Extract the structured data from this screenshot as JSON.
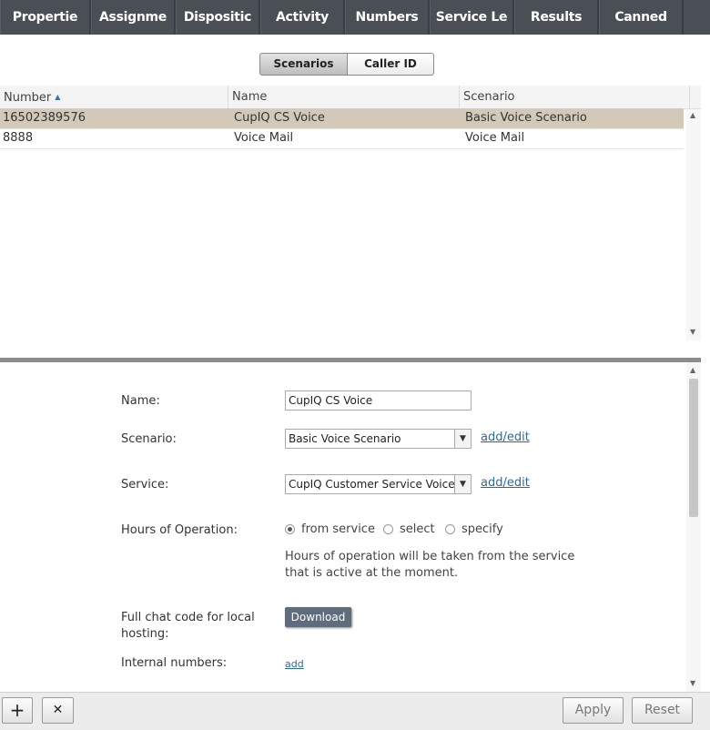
{
  "tabs": [
    "Propertie",
    "Assignme",
    "Dispositic",
    "Activity",
    "Numbers",
    "Service Le",
    "Results",
    "Canned"
  ],
  "segmented": {
    "scenarios": "Scenarios",
    "caller_id": "Caller ID"
  },
  "table": {
    "headers": [
      "Number",
      "Name",
      "Scenario"
    ],
    "rows": [
      {
        "number": "16502389576",
        "name": "CupIQ CS Voice",
        "scenario": "Basic Voice Scenario",
        "selected": true
      },
      {
        "number": "8888",
        "name": "Voice Mail",
        "scenario": "Voice Mail",
        "selected": false
      }
    ]
  },
  "form": {
    "name_label": "Name:",
    "name_value": "CupIQ CS Voice",
    "scenario_label": "Scenario:",
    "scenario_value": "Basic Voice Scenario",
    "service_label": "Service:",
    "service_value": "CupIQ Customer Service Voice",
    "add_edit": "add/edit",
    "hours_label": "Hours of Operation:",
    "hours_options": [
      "from service",
      "select",
      "specify"
    ],
    "hours_selected": "from service",
    "hours_note": "Hours of operation will be taken from the service that is active at the moment.",
    "chat_label": "Full chat code for local hosting:",
    "download_label": "Download",
    "internal_label": "Internal numbers:",
    "add_label": "add"
  },
  "bottom": {
    "add": "+",
    "remove": "✕",
    "apply": "Apply",
    "reset": "Reset"
  },
  "icons": {
    "sort": "sort-asc-icon",
    "dropdown": "chevron-down-icon"
  }
}
